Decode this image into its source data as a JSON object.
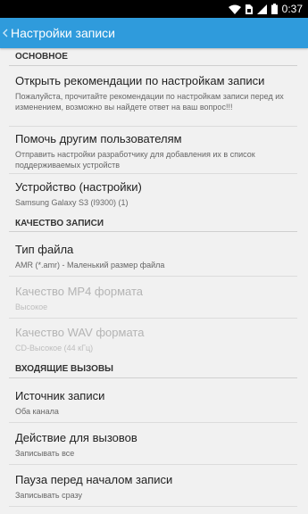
{
  "status_bar": {
    "time": "0:37",
    "icons": [
      "wifi-icon",
      "sim-icon",
      "signal-icon",
      "battery-icon"
    ]
  },
  "action_bar": {
    "title": "Настройки записи",
    "back_icon": "chevron-left-icon",
    "color": "#2f9bdc"
  },
  "sections": [
    {
      "header": "ОСНОВНОЕ"
    },
    {
      "header": "КАЧЕСТВО ЗАПИСИ"
    },
    {
      "header": "ВХОДЯЩИЕ ВЫЗОВЫ"
    }
  ],
  "prefs": [
    {
      "title": "Открыть рекомендации по настройкам записи",
      "summary": "Пожалуйста, прочитайте рекомендации по настройкам записи перед их изменением, возможно вы найдете ответ на ваш вопрос!!!",
      "enabled": true
    },
    {
      "title": "Помочь другим пользователям",
      "summary": "Отправить настройки разработчику для добавления их в список поддерживаемых устройств",
      "enabled": true
    },
    {
      "title": "Устройство (настройки)",
      "summary": "Samsung Galaxy S3 (I9300) (1)",
      "enabled": true
    },
    {
      "title": "Тип файла",
      "summary": "AMR (*.amr) - Маленький размер файла",
      "enabled": true
    },
    {
      "title": "Качество MP4 формата",
      "summary": "Высокое",
      "enabled": false
    },
    {
      "title": "Качество WAV формата",
      "summary": "CD-Высокое (44 кГц)",
      "enabled": false
    },
    {
      "title": "Источник записи",
      "summary": "Оба канала",
      "enabled": true
    },
    {
      "title": "Действие для вызовов",
      "summary": "Записывать все",
      "enabled": true
    },
    {
      "title": "Пауза перед началом записи",
      "summary": "Записывать сразу",
      "enabled": true
    }
  ]
}
